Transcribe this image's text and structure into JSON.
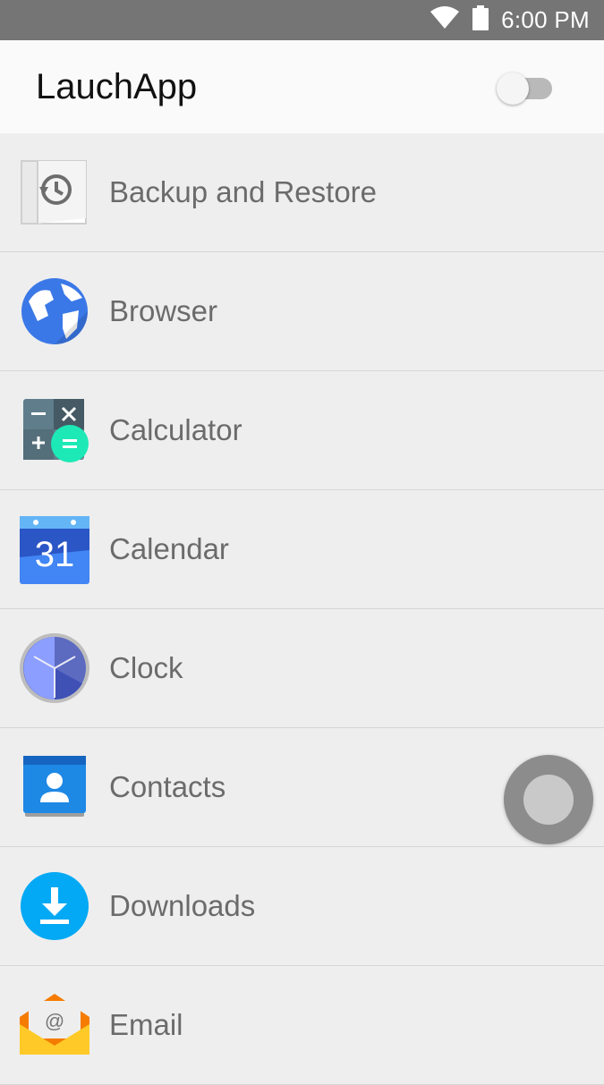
{
  "status_bar": {
    "time": "6:00 PM",
    "icons": [
      "wifi-icon",
      "battery-icon"
    ]
  },
  "app_bar": {
    "title": "LauchApp",
    "toggle_on": false
  },
  "apps": [
    {
      "label": "Backup and Restore",
      "icon": "backup-restore-icon"
    },
    {
      "label": "Browser",
      "icon": "browser-globe-icon"
    },
    {
      "label": "Calculator",
      "icon": "calculator-icon"
    },
    {
      "label": "Calendar",
      "icon": "calendar-icon",
      "icon_text": "31"
    },
    {
      "label": "Clock",
      "icon": "clock-icon"
    },
    {
      "label": "Contacts",
      "icon": "contacts-icon"
    },
    {
      "label": "Downloads",
      "icon": "downloads-icon"
    },
    {
      "label": "Email",
      "icon": "email-icon",
      "icon_text": "@"
    }
  ],
  "colors": {
    "status_bar": "#757575",
    "app_bar": "#fafafa",
    "list_background": "#eeeeee",
    "label_text": "#6b6b6b"
  }
}
